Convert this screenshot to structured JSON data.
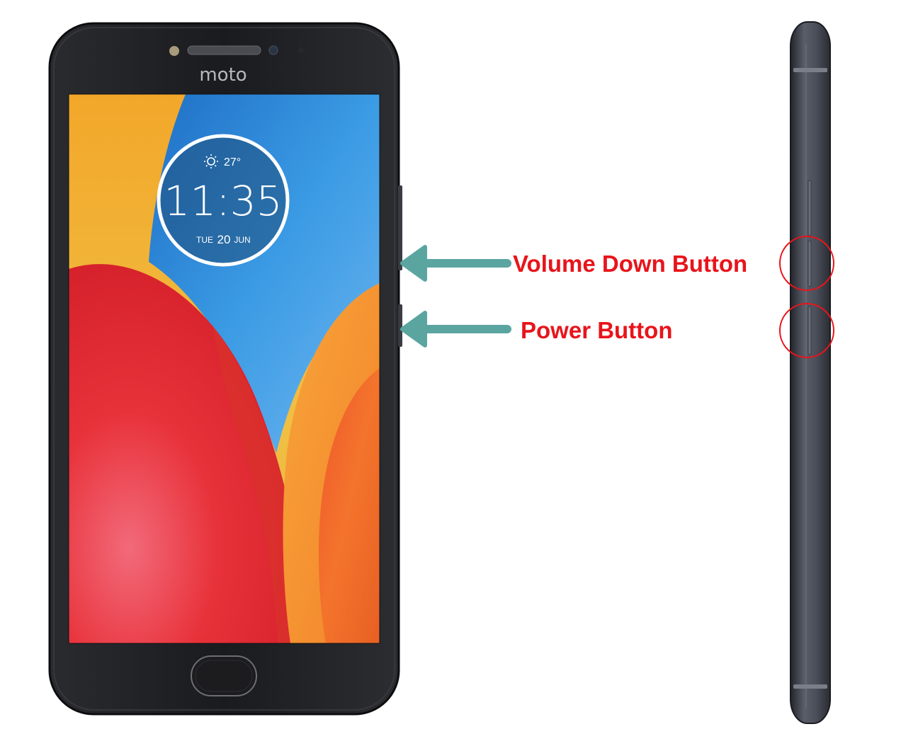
{
  "phone": {
    "brand": "moto",
    "clock_widget": {
      "weather_icon": "sun-icon",
      "temperature": "27°",
      "time": "11:35",
      "day": "TUE",
      "date": "20",
      "month": "JUN"
    }
  },
  "annotations": {
    "volume_down_label": "Volume Down Button",
    "power_label": "Power Button",
    "arrow_color": "#5ba5a1",
    "highlight_color": "#e8141b"
  },
  "colors": {
    "phone_body": "#1e1e21",
    "side_frame": "#4a4d57",
    "wallpaper_blue": "#2f8fd8",
    "wallpaper_red": "#e8303a",
    "wallpaper_orange": "#f39a2a",
    "wallpaper_yellow": "#f2b33a"
  }
}
